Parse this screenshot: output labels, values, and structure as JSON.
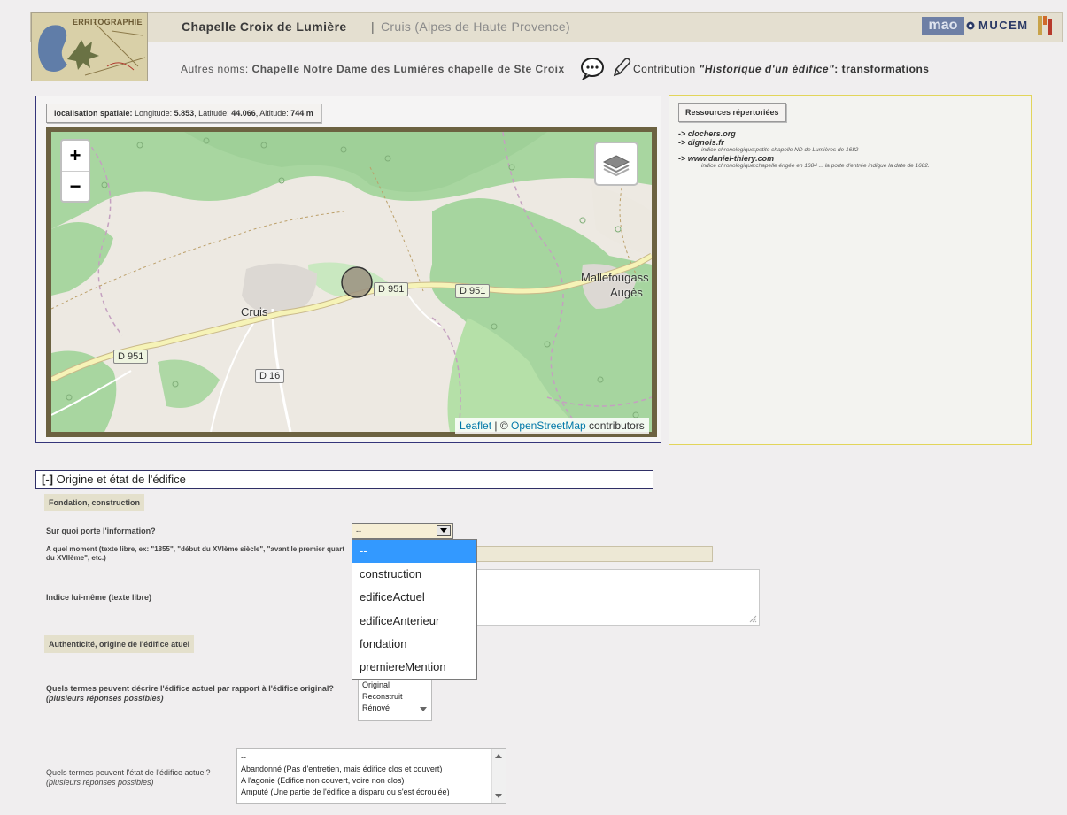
{
  "header": {
    "logo_text": "ERRITOGRAPHIE",
    "title": "Chapelle Croix de Lumière",
    "separator": "|",
    "location": "Cruis (Alpes de Haute Provence)",
    "brand_mao": "mao",
    "brand_mucem": "MUCEM",
    "alt_names_label": "Autres noms:",
    "alt_names_value": "Chapelle Notre Dame des Lumières chapelle de Ste Croix",
    "contribution_prefix": "Contribution ",
    "contribution_link": "\"Historique d'un édifice\"",
    "contribution_suffix": ": transformations"
  },
  "location": {
    "label": "localisation spatiale:",
    "longitude_label": "Longitude:",
    "longitude": "5.853",
    "latitude_label": ", Latitude:",
    "latitude": "44.066",
    "altitude_label": ", Altitude:",
    "altitude": "744 m"
  },
  "map": {
    "zoom_in": "+",
    "zoom_out": "−",
    "labels": {
      "cruis": "Cruis",
      "mallefougass": "Mallefougass",
      "auges": "Augès",
      "d951_a": "D 951",
      "d951_b": "D 951",
      "d951_c": "D 951",
      "d16": "D 16"
    },
    "attribution_leaflet": "Leaflet",
    "attribution_sep": " | © ",
    "attribution_osm": "OpenStreetMap",
    "attribution_tail": " contributors"
  },
  "resources": {
    "heading": "Ressources répertoriées",
    "items": [
      {
        "link": "-> clochers.org",
        "note": ""
      },
      {
        "link": "-> dignois.fr",
        "note": "indice chronologique:petite chapelle ND de Lumières de 1682"
      },
      {
        "link": "-> www.daniel-thiery.com",
        "note": "indice chronologique:chapelle érigée en 1684 ... la porte d'entrée indique la date de 1682."
      }
    ]
  },
  "section": {
    "toggle": "[-]",
    "title": " Origine et état de l'édifice",
    "fondation_head": "Fondation, construction",
    "q_info": "Sur quoi porte l'information?",
    "select_value": "--",
    "q_moment": "A quel moment (texte libre, ex: \"1855\", \"début du XVIème siècle\", \"avant le premier quart du XVIIème\", etc.)",
    "q_indice": "Indice lui-même (texte libre)",
    "auth_head": "Authenticité, origine de l'édifice atuel",
    "q_terms": "Quels termes peuvent décrire l'édifice actuel par rapport à l'édifice original?",
    "q_terms_note": "(plusieurs réponses possibles)",
    "terms_options": [
      "Original",
      "Reconstruit",
      "Rénové"
    ],
    "q_etat": "Quels termes peuvent l'état de l'édifice actuel?",
    "q_etat_note": "(plusieurs réponses possibles)",
    "etat_options": [
      "--",
      "Abandonné (Pas d'entretien, mais édifice clos et couvert)",
      "A l'agonie (Edifice non couvert, voire non clos)",
      "Amputé (Une partie de l'édifice a disparu ou s'est écroulée)"
    ]
  },
  "dropdown_options": [
    "--",
    "construction",
    "edificeActuel",
    "edificeAnterieur",
    "fondation",
    "premiereMention"
  ],
  "colors": {
    "dropdown_selected": "#3399ff",
    "map_border": "#6c6241",
    "resources_border": "#e2d55a"
  }
}
